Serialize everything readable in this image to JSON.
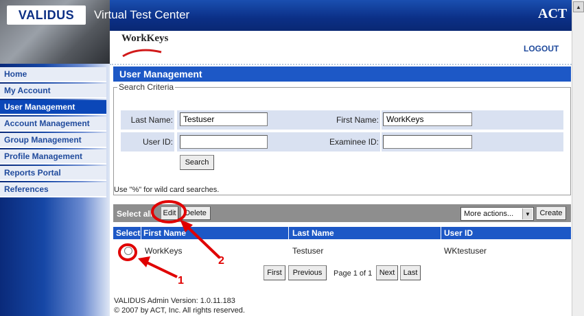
{
  "header": {
    "logo": "VALIDUS",
    "title": "Virtual Test Center",
    "act_logo": "ACT",
    "product_logo": "WorkKeys",
    "logout": "LOGOUT"
  },
  "sidebar": {
    "items": [
      {
        "label": "Home"
      },
      {
        "label": "My Account"
      },
      {
        "label": "User Management"
      },
      {
        "label": "Account Management"
      },
      {
        "label": "Group Management"
      },
      {
        "label": "Profile Management"
      },
      {
        "label": "Reports Portal"
      },
      {
        "label": "References"
      }
    ],
    "active": "User Management"
  },
  "main": {
    "page_title": "User Management",
    "criteria_legend": "Search Criteria",
    "fields": {
      "last_name_label": "Last Name:",
      "last_name_value": "Testuser",
      "first_name_label": "First Name:",
      "first_name_value": "WorkKeys",
      "user_id_label": "User ID:",
      "user_id_value": "",
      "examinee_id_label": "Examinee ID:",
      "examinee_id_value": ""
    },
    "search_button": "Search",
    "wildcard_hint": "Use \"%\" for wild card searches.",
    "toolbar": {
      "select_all": "Select all",
      "edit": "Edit",
      "delete": "Delete",
      "more_actions": "More actions...",
      "create": "Create"
    },
    "table": {
      "columns": [
        "Select",
        "First Name",
        "Last Name",
        "User ID"
      ],
      "rows": [
        {
          "first_name": "WorkKeys",
          "last_name": "Testuser",
          "user_id": "WKtestuser"
        }
      ]
    },
    "pagination": {
      "first": "First",
      "previous": "Previous",
      "info": "Page 1 of 1",
      "next": "Next",
      "last": "Last"
    }
  },
  "footer": {
    "version": "VALIDUS Admin Version: 1.0.11.183",
    "copyright": "© 2007 by ACT, Inc. All rights reserved."
  },
  "annotations": {
    "label_1": "1",
    "label_2": "2",
    "color": "#e00000"
  },
  "colors": {
    "brand_blue": "#1d58c6",
    "nav_text": "#1f4a9c",
    "toolbar_gray": "#8e8e8e"
  }
}
